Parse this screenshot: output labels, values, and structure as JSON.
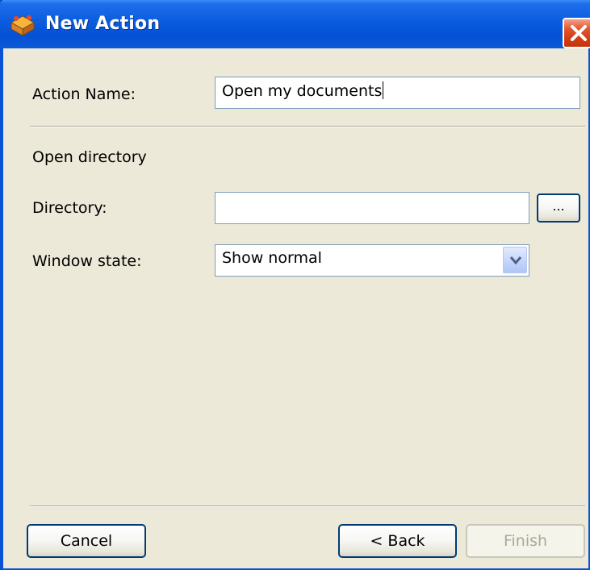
{
  "window": {
    "title": "New Action",
    "icon": "toolbox-icon",
    "close_icon": "close-icon"
  },
  "form": {
    "action_name_label": "Action Name:",
    "action_name_value": "Open my documents",
    "section_title": "Open directory",
    "directory_label": "Directory:",
    "directory_value": "",
    "browse_label": "...",
    "window_state_label": "Window state:",
    "window_state_value": "Show normal"
  },
  "buttons": {
    "cancel": "Cancel",
    "back": "< Back",
    "finish": "Finish"
  },
  "colors": {
    "titlebar": "#0a5ce0",
    "dialog_bg": "#ece9d8",
    "close_button": "#d33d14",
    "button_border": "#003c74",
    "disabled_text": "#aca899"
  }
}
